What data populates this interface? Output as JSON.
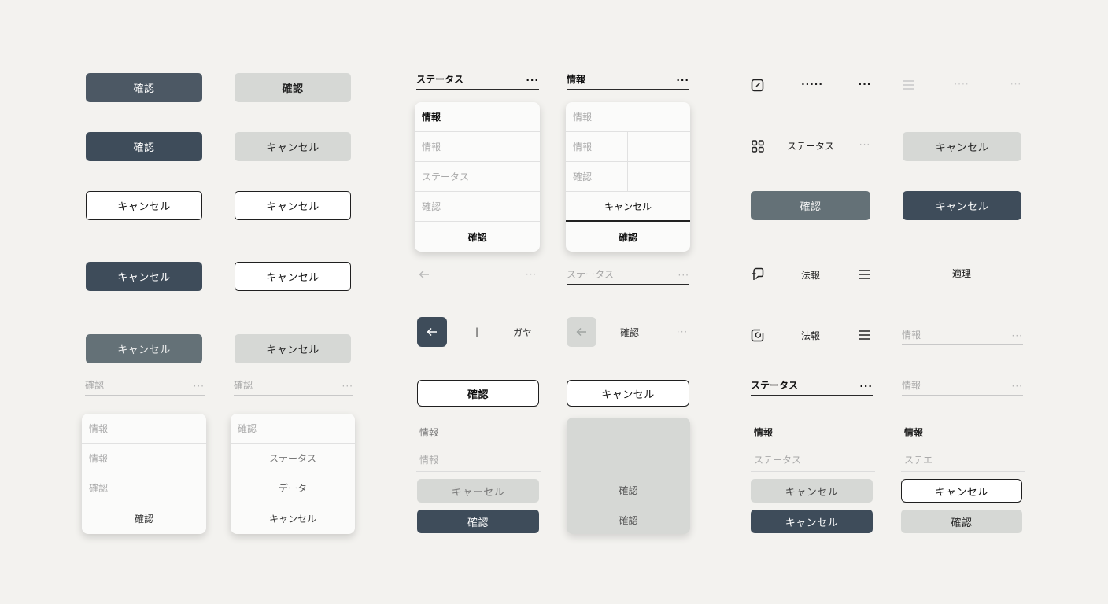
{
  "col1": {
    "b1": "確認",
    "b2": "確認",
    "b3": "キャンセル",
    "b4": "キャンセル",
    "b5": "キャンセル",
    "field": {
      "label": "確認",
      "menu": "···"
    },
    "card": [
      "情報",
      "情報",
      "確認",
      "確認"
    ]
  },
  "col2": {
    "b1": "確認",
    "b2": "キャンセル",
    "b3": "キャンセル",
    "b4": "キャンセル",
    "b5": "キャンセル",
    "field": {
      "label": "確認",
      "menu": "···"
    },
    "card": [
      "確認",
      "ステータス",
      "データ",
      "キャンセル"
    ]
  },
  "col3": {
    "field_top": {
      "label": "ステータス",
      "menu": "···"
    },
    "card": [
      "情報",
      "情報",
      "ステータス",
      "確認",
      "確認"
    ],
    "nav_menu": "···",
    "divider": "|",
    "nav_text": "ガヤ",
    "outline_button": "確認",
    "list": [
      "情報",
      "情報"
    ],
    "light_button": "キャーセル",
    "dark_button": "確認"
  },
  "col4": {
    "field_top": {
      "label": "情報",
      "menu": "···"
    },
    "card": [
      "情報",
      "情報",
      "確認",
      "キャンセル",
      "確認"
    ],
    "field_mid": {
      "label": "ステータス",
      "menu": "···"
    },
    "nav_text": "確認",
    "nav_menu": "···",
    "outline_button": "キャンセル",
    "panel": [
      "確認",
      "確認"
    ]
  },
  "col5": {
    "toolbar_dots": "·····",
    "toolbar_more": "···",
    "grid_label": "ステータス",
    "grid_more": "···",
    "gray_button": "確認",
    "row_a_text": "法報",
    "row_b_text": "法報",
    "field": {
      "label": "ステータス",
      "menu": "···"
    },
    "list": [
      "情報",
      "ステータス"
    ],
    "light_button": "キャンセル",
    "dark_button": "キャンセル"
  },
  "col6": {
    "toolbar_dots": "····",
    "toolbar_more": "···",
    "light_button": "キャンセル",
    "dark_button": "キャンセル",
    "tab_label": "適理",
    "field1": {
      "label": "情報",
      "menu": "···"
    },
    "field2": {
      "label": "情報",
      "menu": "···"
    },
    "list": [
      "情報",
      "ステエ"
    ],
    "outline_button": "キャンセル",
    "light_button2": "確認"
  },
  "colors": {
    "dark": "#3e4c5a",
    "slate": "#4c5864",
    "gray": "#647177",
    "light": "#d6d8d5",
    "background": "#f3f2ef"
  }
}
